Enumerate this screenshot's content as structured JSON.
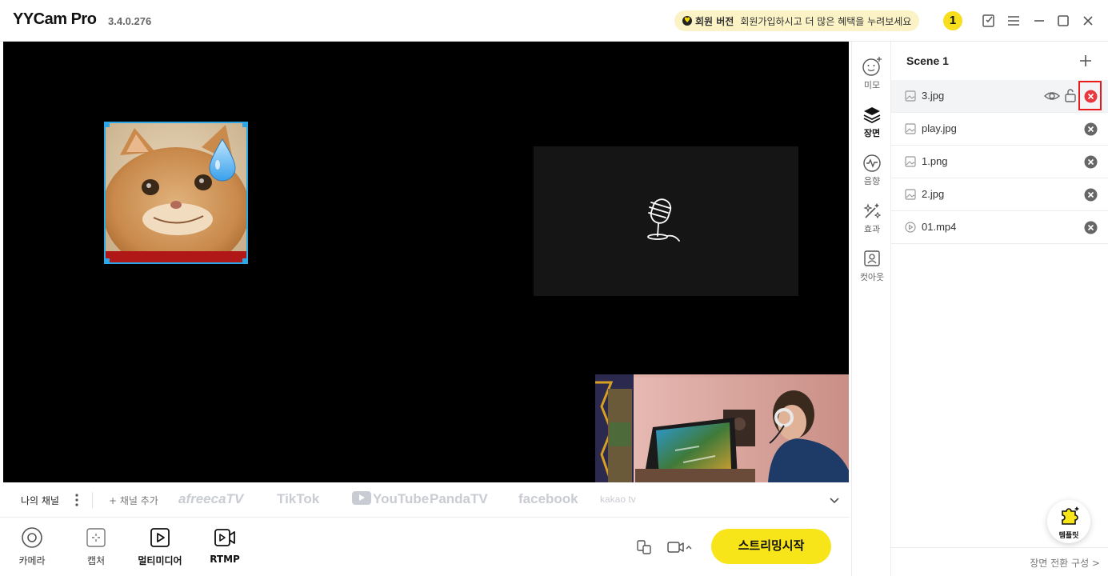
{
  "app": {
    "name": "YYCam Pro",
    "version": "3.4.0.276"
  },
  "promo": {
    "badge": "회원 버전",
    "text": "회원가입하시고 더 많은 혜택을 누려보세요"
  },
  "notifications": {
    "count": "1"
  },
  "window_controls": [
    "edit-icon",
    "menu-icon",
    "minimize-icon",
    "maximize-icon",
    "close-icon"
  ],
  "channel_bar": {
    "my_channel": "나의 채널",
    "add_channel": "+ 채널 추가",
    "platforms": [
      "afreecaTV",
      "TikTok",
      "YouTube",
      "PandaTV",
      "facebook",
      "kakao tv"
    ]
  },
  "toolbar": {
    "tools": [
      {
        "label": "카메라",
        "icon": "camera-icon"
      },
      {
        "label": "캡처",
        "icon": "capture-icon"
      },
      {
        "label": "멀티미디어",
        "icon": "multimedia-icon"
      },
      {
        "label": "RTMP",
        "icon": "rtmp-icon"
      }
    ],
    "stream_button": "스트리밍시작"
  },
  "rail": {
    "items": [
      {
        "label": "미모",
        "icon": "face-icon"
      },
      {
        "label": "장면",
        "icon": "layers-icon"
      },
      {
        "label": "음향",
        "icon": "audio-icon"
      },
      {
        "label": "효과",
        "icon": "effects-icon"
      },
      {
        "label": "컷아웃",
        "icon": "cutout-icon"
      }
    ]
  },
  "scene": {
    "title": "Scene 1",
    "layers": [
      {
        "name": "3.jpg",
        "type": "image",
        "selected": true
      },
      {
        "name": "play.jpg",
        "type": "image"
      },
      {
        "name": "1.png",
        "type": "image"
      },
      {
        "name": "2.jpg",
        "type": "image"
      },
      {
        "name": "01.mp4",
        "type": "video"
      }
    ],
    "template_label": "템플릿",
    "transition_label": "장면 전환 구성 >"
  },
  "colors": {
    "accent_yellow": "#f7e51a",
    "selection_blue": "#2ba7e8",
    "delete_red": "#e8383d",
    "highlight_red": "#e81c1c"
  }
}
